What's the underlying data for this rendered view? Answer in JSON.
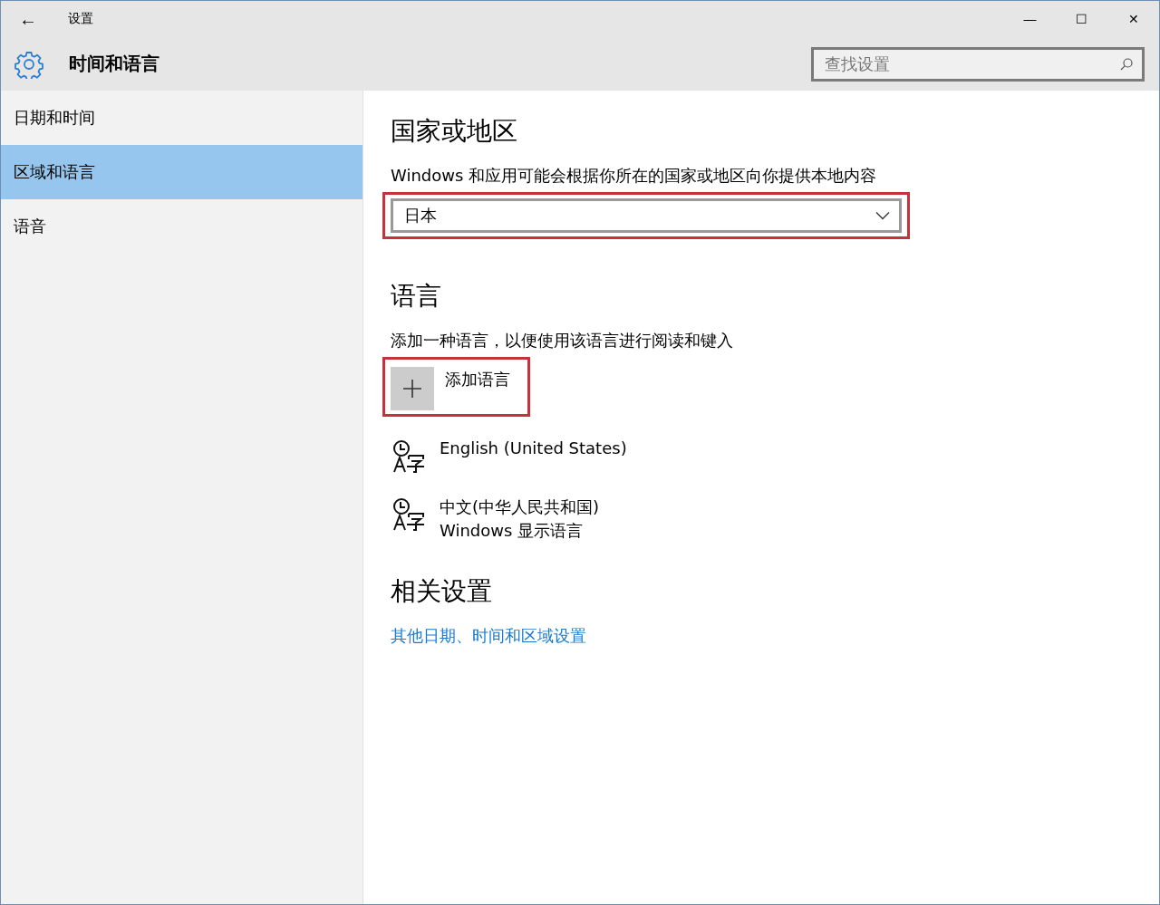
{
  "window": {
    "title": "设置",
    "back": "←",
    "controls": [
      "—",
      "☐",
      "✕"
    ]
  },
  "header": {
    "title": "时间和语言",
    "search": {
      "placeholder": "查找设置"
    }
  },
  "sidebar": {
    "items": [
      {
        "label": "日期和时间",
        "selected": false
      },
      {
        "label": "区域和语言",
        "selected": true
      },
      {
        "label": "语音",
        "selected": false
      }
    ]
  },
  "region": {
    "heading": "国家或地区",
    "description": "Windows 和应用可能会根据你所在的国家或地区向你提供本地内容",
    "dropdown": {
      "value": "日本"
    },
    "highlighted": true
  },
  "languages": {
    "heading": "语言",
    "description": "添加一种语言，以便使用该语言进行阅读和键入",
    "add": {
      "label": "添加语言",
      "highlighted": true
    },
    "items": [
      {
        "name": "English (United States)"
      },
      {
        "name": "中文(中华人民共和国)",
        "detail": "Windows 显示语言"
      }
    ]
  },
  "related": {
    "heading": "相关设置",
    "link": "其他日期、时间和区域设置"
  }
}
